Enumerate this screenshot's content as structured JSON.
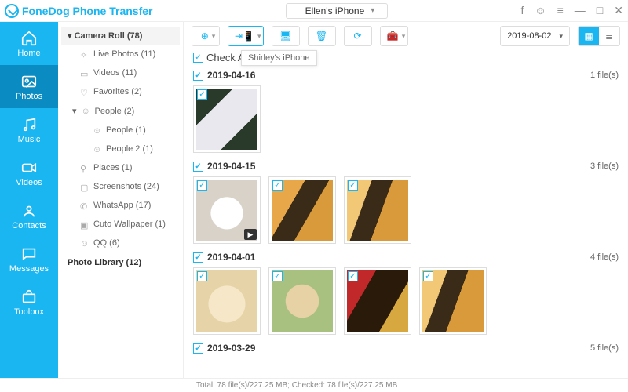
{
  "app": {
    "title": "FoneDog Phone Transfer"
  },
  "device": {
    "selected": "Ellen's iPhone"
  },
  "leftnav": [
    {
      "label": "Home"
    },
    {
      "label": "Photos"
    },
    {
      "label": "Music"
    },
    {
      "label": "Videos"
    },
    {
      "label": "Contacts"
    },
    {
      "label": "Messages"
    },
    {
      "label": "Toolbox"
    }
  ],
  "sidebar": {
    "header": "Camera Roll (78)",
    "items": [
      {
        "label": "Live Photos (11)"
      },
      {
        "label": "Videos (11)"
      },
      {
        "label": "Favorites (2)"
      },
      {
        "label": "People (2)",
        "expanded": true
      },
      {
        "label": "People (1)",
        "sub": true
      },
      {
        "label": "People 2 (1)",
        "sub": true
      },
      {
        "label": "Places (1)"
      },
      {
        "label": "Screenshots (24)"
      },
      {
        "label": "WhatsApp (17)"
      },
      {
        "label": "Cuto Wallpaper (1)"
      },
      {
        "label": "QQ (6)"
      }
    ],
    "library": "Photo Library (12)"
  },
  "toolbar": {
    "tooltip": "Shirley's iPhone",
    "date": "2019-08-02"
  },
  "content": {
    "checkall": "Check All(78)",
    "groups": [
      {
        "date": "2019-04-16",
        "count": "1 file(s)",
        "thumbs": 1
      },
      {
        "date": "2019-04-15",
        "count": "3 file(s)",
        "thumbs": 3
      },
      {
        "date": "2019-04-01",
        "count": "4 file(s)",
        "thumbs": 4
      },
      {
        "date": "2019-03-29",
        "count": "5 file(s)",
        "thumbs": 0
      }
    ]
  },
  "status": {
    "text": "Total: 78 file(s)/227.25 MB; Checked: 78 file(s)/227.25 MB"
  },
  "thumbs_css": {
    "g0": [
      "linear-gradient(135deg,#2a3a2a 0 30%,#e8e8ee 30% 70%,#2a3a2a 70%)"
    ],
    "g1": [
      "radial-gradient(circle at 50% 55%,#fff 0 35%,#d8d2c8 36% 100%)",
      "linear-gradient(120deg,#e8a84a 0 35%,#3a2a18 35% 60%,#d89a3a 60% 100%)",
      "linear-gradient(110deg,#f2c877 0 30%,#3a2a18 30% 55%,#d89a3a 55% 100%)"
    ],
    "g2": [
      "radial-gradient(circle at 50% 55%,#f6e7c8 0 40%,#e6d4a8 41% 100%)",
      "radial-gradient(circle at 50% 50%,#e7d2a5 0 38%,#a8c080 39% 100%)",
      "linear-gradient(120deg,#c0282a 0 30%,#2a1a0a 30% 70%,#d8a840 70% 100%)",
      "linear-gradient(110deg,#f2c877 0 30%,#3a2a18 30% 55%,#d89a3a 55% 100%)"
    ]
  }
}
